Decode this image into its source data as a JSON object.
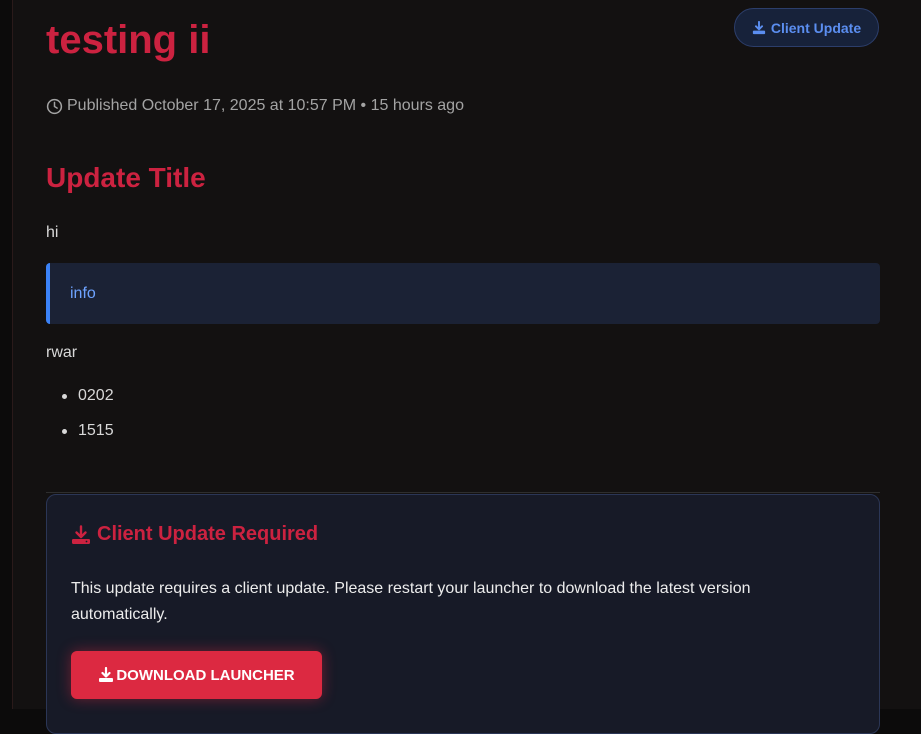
{
  "post": {
    "title": "testing ii",
    "badge_label": "Client Update",
    "meta": "Published October 17, 2025 at 10:57 PM • 15 hours ago"
  },
  "content": {
    "heading": "Update Title",
    "paragraph_1": "hi",
    "info_text": "info",
    "paragraph_2": "rwar",
    "list_items": [
      "0202",
      "1515"
    ]
  },
  "notice": {
    "title": "Client Update Required",
    "text": "This update requires a client update. Please restart your launcher to download the latest version automatically.",
    "button_label": "DOWNLOAD LAUNCHER"
  },
  "icons": {
    "badge_icon": "download-icon",
    "meta_icon": "clock-icon",
    "notice_icon": "download-icon",
    "button_icon": "download-icon"
  },
  "colors": {
    "accent_red": "#cc2240",
    "accent_blue": "#3b82f6",
    "button_red": "#dc2941"
  }
}
